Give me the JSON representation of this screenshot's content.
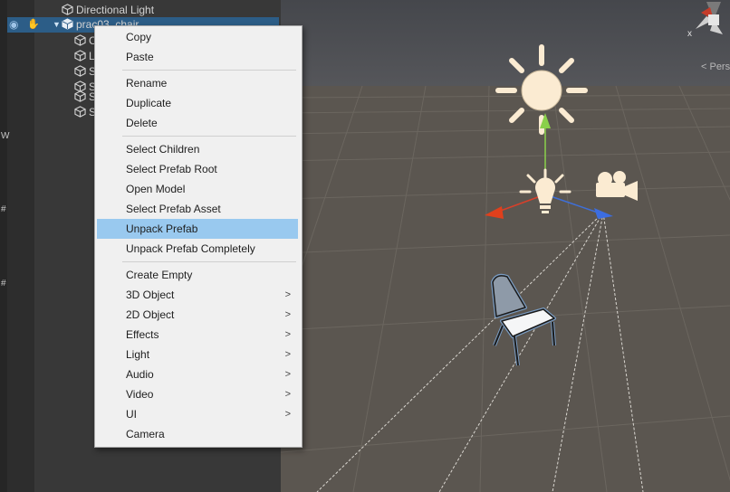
{
  "hierarchy": {
    "items": [
      {
        "label": "Directional Light",
        "icon": "cube-icon"
      },
      {
        "label": "prac03_chair",
        "icon": "prefab-cube-icon",
        "selected": true
      }
    ],
    "children": [
      "C",
      "L",
      "S",
      "S",
      "S",
      "S"
    ],
    "side_marks": [
      "W",
      "#",
      "#"
    ]
  },
  "scene": {
    "persp_label": "< Persp",
    "gizmo_axis_label": "x",
    "colors": {
      "ground": "#5b5650",
      "sky": "#4c4e53",
      "highlight_outline": "#7a9cc2"
    }
  },
  "context_menu": {
    "items": [
      {
        "label": "Copy"
      },
      {
        "label": "Paste"
      },
      {
        "label": "Rename"
      },
      {
        "label": "Duplicate"
      },
      {
        "label": "Delete"
      },
      {
        "label": "Select Children"
      },
      {
        "label": "Select Prefab Root"
      },
      {
        "label": "Open Model"
      },
      {
        "label": "Select Prefab Asset"
      },
      {
        "label": "Unpack Prefab",
        "highlighted": true
      },
      {
        "label": "Unpack Prefab Completely"
      },
      {
        "label": "Create Empty"
      },
      {
        "label": "3D Object",
        "submenu": true
      },
      {
        "label": "2D Object",
        "submenu": true
      },
      {
        "label": "Effects",
        "submenu": true
      },
      {
        "label": "Light",
        "submenu": true
      },
      {
        "label": "Audio",
        "submenu": true
      },
      {
        "label": "Video",
        "submenu": true
      },
      {
        "label": "UI",
        "submenu": true
      },
      {
        "label": "Camera"
      }
    ],
    "submenu_arrow": ">"
  }
}
